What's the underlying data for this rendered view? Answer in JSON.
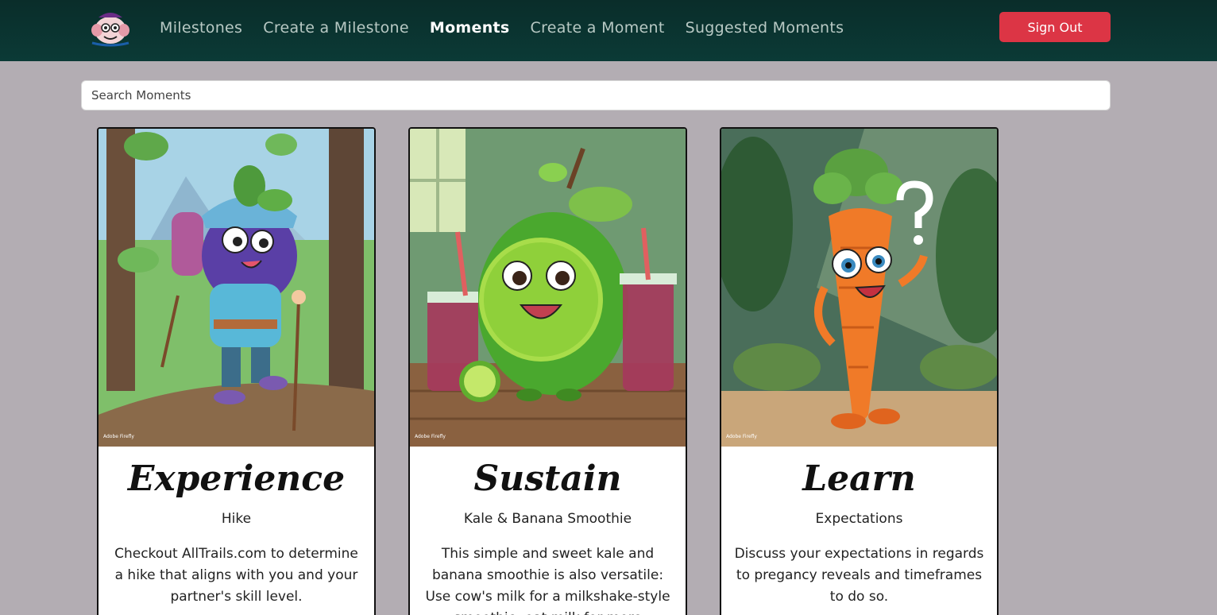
{
  "nav": {
    "logo_icon": "monkey-mascot-logo",
    "links": [
      {
        "label": "Milestones",
        "active": false
      },
      {
        "label": "Create a Milestone",
        "active": false
      },
      {
        "label": "Moments",
        "active": true
      },
      {
        "label": "Create a Moment",
        "active": false
      },
      {
        "label": "Suggested Moments",
        "active": false
      }
    ],
    "signout_label": "Sign Out"
  },
  "search": {
    "placeholder": "Search Moments",
    "value": ""
  },
  "colors": {
    "nav_bg": "#0a2d2a",
    "page_bg": "#b3adb3",
    "signout": "#dc3545"
  },
  "cards": [
    {
      "image": "blueberry-hiker-illustration",
      "watermark": "Adobe Firefly",
      "title": "Experience",
      "subtitle": "Hike",
      "text": "Checkout AllTrails.com to determine a hike that aligns with you and your partner's skill level."
    },
    {
      "image": "lime-smoothie-illustration",
      "watermark": "Adobe Firefly",
      "title": "Sustain",
      "subtitle": "Kale & Banana Smoothie",
      "text": "This simple and sweet kale and banana smoothie is also versatile: Use cow's milk for a milkshake-style smoothie, oat milk for more"
    },
    {
      "image": "carrot-question-illustration",
      "watermark": "Adobe Firefly",
      "title": "Learn",
      "subtitle": "Expectations",
      "text": "Discuss your expectations in regards to pregancy reveals and timeframes to do so."
    }
  ]
}
